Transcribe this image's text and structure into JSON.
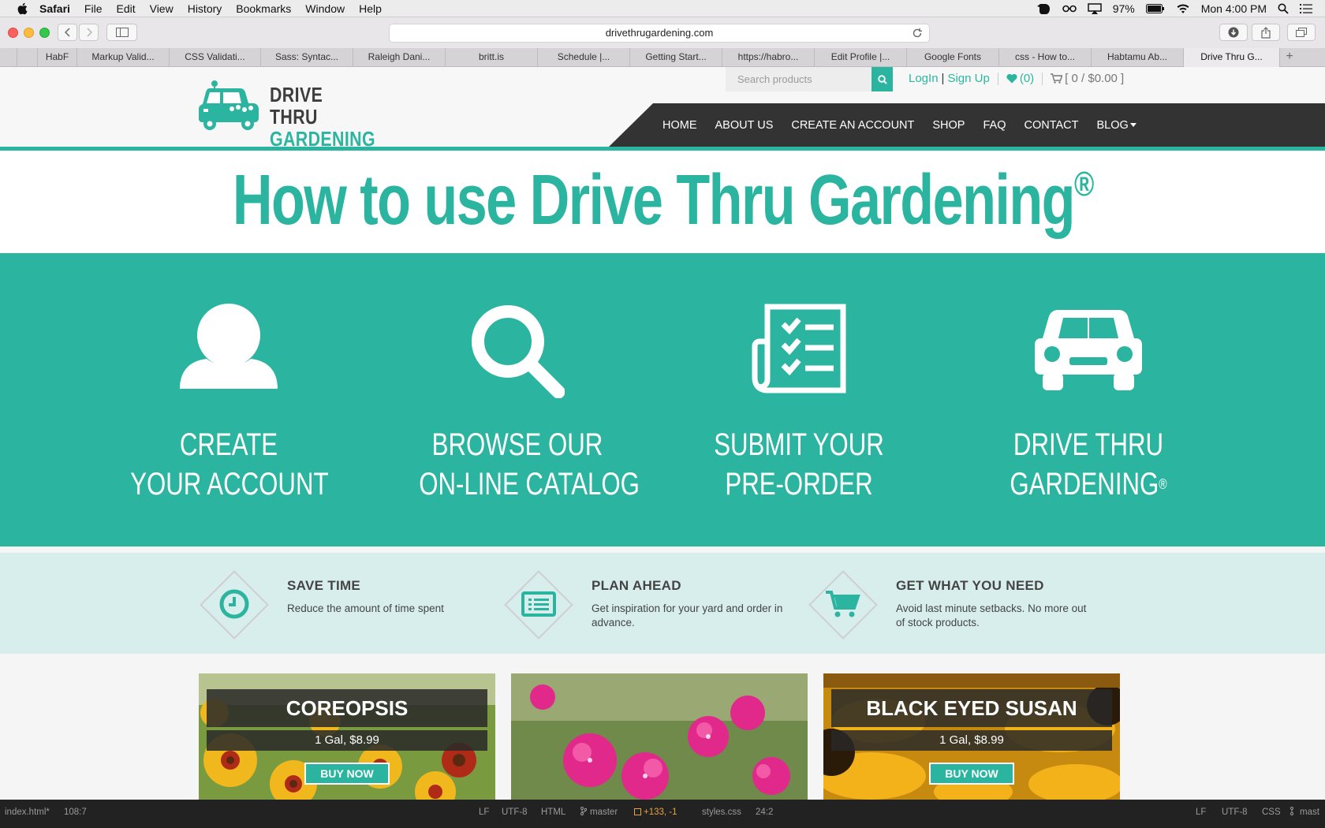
{
  "menubar": {
    "app": "Safari",
    "items": [
      "File",
      "Edit",
      "View",
      "History",
      "Bookmarks",
      "Window",
      "Help"
    ],
    "battery": "97%",
    "clock": "Mon 4:00 PM"
  },
  "browser": {
    "url": "drivethrugardening.com",
    "tabs": [
      "HabF",
      "Markup Valid...",
      "CSS Validati...",
      "Sass: Syntac...",
      "Raleigh Dani...",
      "britt.is",
      "Schedule |...",
      "Getting Start...",
      "https://habro...",
      "Edit Profile |...",
      "Google Fonts",
      "css - How to...",
      "Habtamu Ab...",
      "Drive Thru G..."
    ],
    "active_tab": 13,
    "new_tab": "+"
  },
  "site": {
    "logo_line1": "DRIVE THRU",
    "logo_line2": "GARDENING",
    "search_placeholder": "Search products",
    "login": "LogIn",
    "login_sep": "|",
    "signup": "Sign Up",
    "wishlist": "(0)",
    "cart": "[ 0 / $0.00 ]",
    "nav": [
      "HOME",
      "ABOUT US",
      "CREATE AN ACCOUNT",
      "SHOP",
      "FAQ",
      "CONTACT",
      "BLOG"
    ]
  },
  "headline": {
    "text": "How to use Drive Thru Gardening",
    "mark": "®"
  },
  "steps": [
    {
      "line1": "CREATE",
      "line2": "YOUR ACCOUNT",
      "icon": "user-icon"
    },
    {
      "line1": "BROWSE OUR",
      "line2": "ON-LINE CATALOG",
      "icon": "search-icon"
    },
    {
      "line1": "SUBMIT  YOUR",
      "line2": "PRE-ORDER",
      "icon": "checklist-icon"
    },
    {
      "line1": "DRIVE THRU",
      "line2": "GARDENING",
      "mark": "®",
      "icon": "car-icon"
    }
  ],
  "benefits": [
    {
      "title": "SAVE TIME",
      "desc": "Reduce the amount of time spent",
      "icon": "clock-icon"
    },
    {
      "title": "PLAN AHEAD",
      "desc": "Get inspiration for your yard and order in advance.",
      "icon": "list-icon"
    },
    {
      "title": "GET WHAT YOU NEED",
      "desc": "Avoid last minute setbacks. No more out of stock products.",
      "icon": "cart-icon"
    }
  ],
  "products": [
    {
      "name": "COREOPSIS",
      "price": "1 Gal, $8.99",
      "buy": "BUY NOW"
    },
    {
      "name": "",
      "price": "",
      "buy": ""
    },
    {
      "name": "BLACK EYED SUSAN",
      "price": "1 Gal, $8.99",
      "buy": "BUY NOW"
    }
  ],
  "statusbar": {
    "file": "index.html*",
    "cursor": "108:7",
    "eol": "LF",
    "encoding": "UTF-8",
    "grammar": "HTML",
    "branch": "master",
    "diff": "+133, -1",
    "file2": "styles.css",
    "cursor2": "24:2",
    "eol2": "LF",
    "encoding2": "UTF-8",
    "grammar2": "CSS",
    "branch2": "mast"
  },
  "colors": {
    "teal": "#2bb5a0",
    "nav_dark": "#333333",
    "benefit_bg": "#d7eeec"
  }
}
